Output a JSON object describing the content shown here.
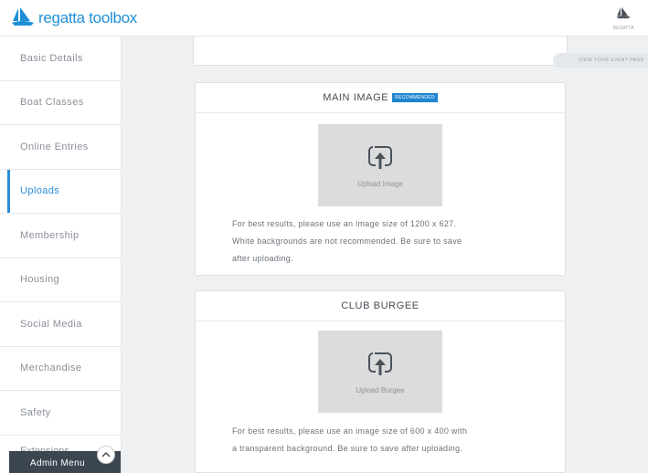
{
  "app": {
    "name": "regatta toolbox",
    "top_icon_caption": "REGATTA"
  },
  "sidebar": {
    "items": [
      {
        "label": "Basic Details",
        "active": false
      },
      {
        "label": "Boat Classes",
        "active": false
      },
      {
        "label": "Online Entries",
        "active": false
      },
      {
        "label": "Uploads",
        "active": true
      },
      {
        "label": "Membership",
        "active": false
      },
      {
        "label": "Housing",
        "active": false
      },
      {
        "label": "Social Media",
        "active": false
      },
      {
        "label": "Merchandise",
        "active": false
      },
      {
        "label": "Safety",
        "active": false
      }
    ],
    "partial_item": "Extensions",
    "admin_menu_label": "Admin Menu"
  },
  "main": {
    "view_page_link": "VIEW YOUR EVENT PAGE",
    "main_image": {
      "title": "MAIN IMAGE",
      "badge": "RECOMMENDED",
      "upload_label": "Upload Image",
      "hint_line1": "For best results, please use an image size of 1200 x 627.",
      "hint_line2": "White backgrounds are not recommended. Be sure to save",
      "hint_line3": "after uploading."
    },
    "club_burgee": {
      "title": "CLUB BURGEE",
      "upload_label": "Upload Burgee",
      "hint_line1": "For best results, please use an image size of 600 x 400 with",
      "hint_line2": "a transparent background. Be sure to save after uploading."
    }
  },
  "colors": {
    "accent": "#1f8fd6",
    "admin_bar": "#3c4651",
    "upload_box": "#dcdcdc"
  },
  "icons": {
    "logo": "sailboat-logo-icon",
    "upload": "upload-icon",
    "toggle": "chevron-up-icon"
  }
}
